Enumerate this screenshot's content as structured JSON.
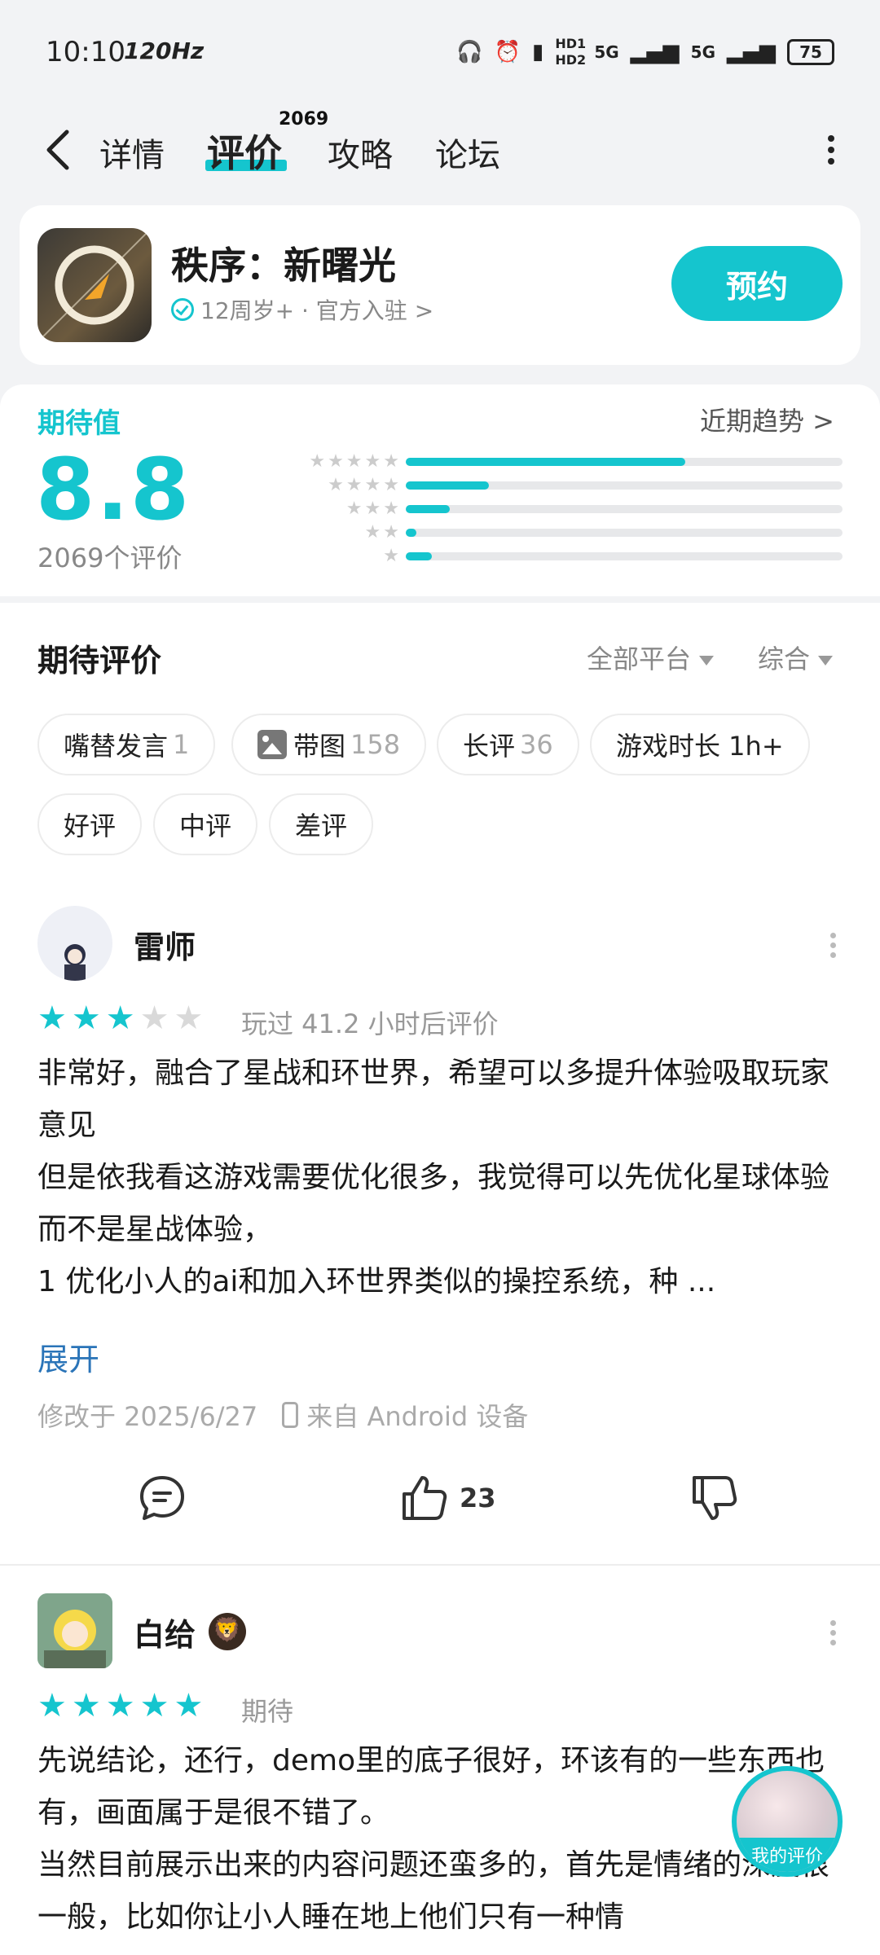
{
  "status_bar": {
    "time": "10:10",
    "refresh": "120Hz",
    "battery": "75",
    "net1": "5G",
    "net2": "5G",
    "hd": "HD1 HD2"
  },
  "nav": {
    "tabs": [
      {
        "label": "详情"
      },
      {
        "label": "评价",
        "count": "2069"
      },
      {
        "label": "攻略"
      },
      {
        "label": "论坛"
      }
    ]
  },
  "app": {
    "name": "秩序：新曙光",
    "meta": "12周岁+ · 官方入驻 >",
    "reserve_label": "预约"
  },
  "rating": {
    "label": "期待值",
    "score": "8.8",
    "count": "2069个评价",
    "trend_link": "近期趋势 >",
    "distribution": [
      0.64,
      0.19,
      0.1,
      0.025,
      0.06
    ]
  },
  "reviews_section": {
    "title": "期待评价",
    "platform_filter": "全部平台",
    "sort_filter": "综合",
    "chips": [
      {
        "label": "嘴替发言",
        "count": "1"
      },
      {
        "label": "带图",
        "count": "158"
      },
      {
        "label": "长评",
        "count": "36"
      },
      {
        "label": "游戏时长 1h+",
        "count": ""
      },
      {
        "label": "好评",
        "count": ""
      },
      {
        "label": "中评",
        "count": ""
      },
      {
        "label": "差评",
        "count": ""
      }
    ]
  },
  "reviews": [
    {
      "user": "雷师",
      "stars": 3,
      "note": "玩过 41.2 小时后评价",
      "body": [
        "非常好，融合了星战和环世界，希望可以多提升体验吸取玩家意见",
        "但是依我看这游戏需要优化很多，我觉得可以先优化星球体验而不是星战体验，",
        "1 优化小人的ai和加入环世界类似的操控系统，种 ..."
      ],
      "expand": "展开",
      "modified": "修改于 2025/6/27",
      "device": "来自 Android 设备",
      "likes": "23"
    },
    {
      "user": "白给",
      "stars": 5,
      "note": "期待",
      "body": [
        "先说结论，还行，demo里的底子很好，环该有的一些东西也有，画面属于是很不错了。",
        "当然目前展示出来的内容问题还蛮多的，首先是情绪的深度很一般，比如你让小人睡在地上他们只有一种情"
      ]
    }
  ],
  "my_review_label": "我的评价",
  "colors": {
    "accent": "#15c5ce",
    "link": "#2a74b8"
  }
}
